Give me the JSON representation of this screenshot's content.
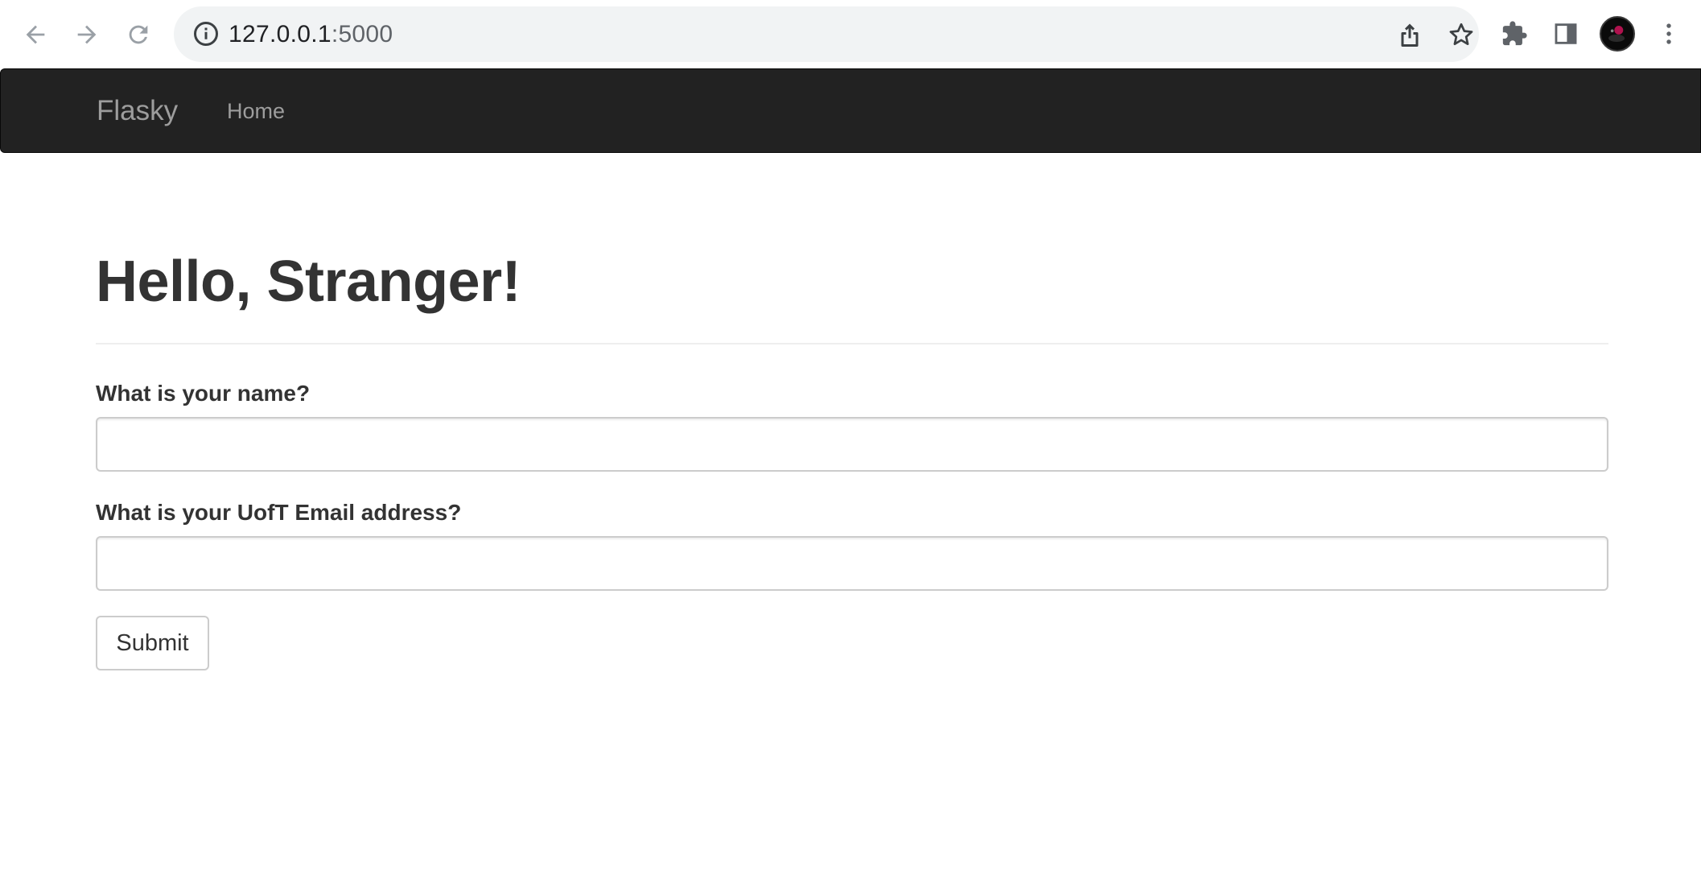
{
  "browser": {
    "url_host": "127.0.0.1",
    "url_port": ":5000",
    "icons": {
      "back": "back-arrow-icon",
      "forward": "forward-arrow-icon",
      "reload": "reload-icon",
      "site_info": "info-icon",
      "share": "share-icon",
      "bookmark": "star-icon",
      "extensions": "puzzle-icon",
      "side_panel": "side-panel-icon",
      "menu": "kebab-menu-icon"
    }
  },
  "navbar": {
    "brand": "Flasky",
    "links": [
      {
        "label": "Home"
      }
    ],
    "background": "#222222",
    "text_color": "#9d9d9d"
  },
  "main": {
    "title": "Hello, Stranger!",
    "form": {
      "name_label": "What is your name?",
      "name_value": "",
      "email_label": "What is your UofT Email address?",
      "email_value": "",
      "submit_label": "Submit"
    }
  }
}
